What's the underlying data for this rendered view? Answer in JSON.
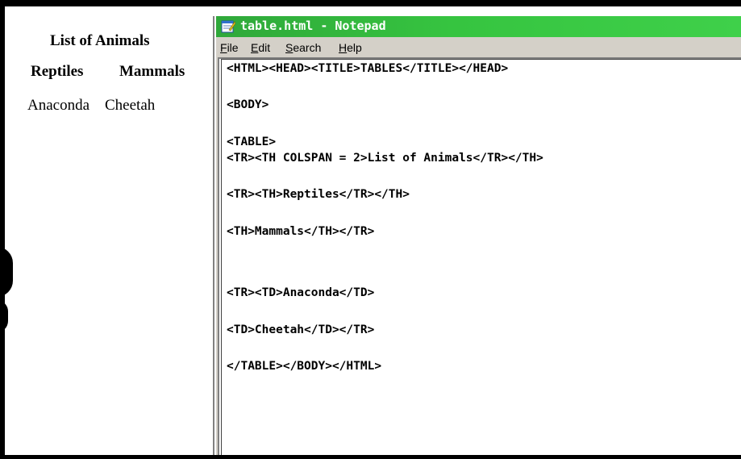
{
  "browser_page": {
    "table_heading": "List of Animals",
    "col_headers": [
      "Reptiles",
      "Mammals"
    ],
    "row_cells": [
      "Anaconda",
      "Cheetah"
    ]
  },
  "notepad": {
    "title": "table.html - Notepad",
    "menu": [
      {
        "label_pre": "",
        "label_u": "F",
        "label_post": "ile"
      },
      {
        "label_pre": "",
        "label_u": "E",
        "label_post": "dit"
      },
      {
        "label_pre": "",
        "label_u": "S",
        "label_post": "earch"
      },
      {
        "label_pre": "",
        "label_u": "H",
        "label_post": "elp"
      }
    ],
    "code_lines": [
      "<HTML><HEAD><TITLE>TABLES</TITLE></HEAD>",
      "<BODY>",
      "<TABLE>",
      "<TR><TH COLSPAN = 2>List of Animals</TR></TH>",
      "<TR><TH>Reptiles</TR></TH>",
      "<TH>Mammals</TH></TR>",
      "<TR><TD>Anaconda</TD>",
      "<TD>Cheetah</TD></TR>",
      "</TABLE></BODY></HTML>"
    ]
  },
  "colors": {
    "titlebar": "#36c440",
    "window_face": "#d4d0c8",
    "frame": "#000000"
  }
}
